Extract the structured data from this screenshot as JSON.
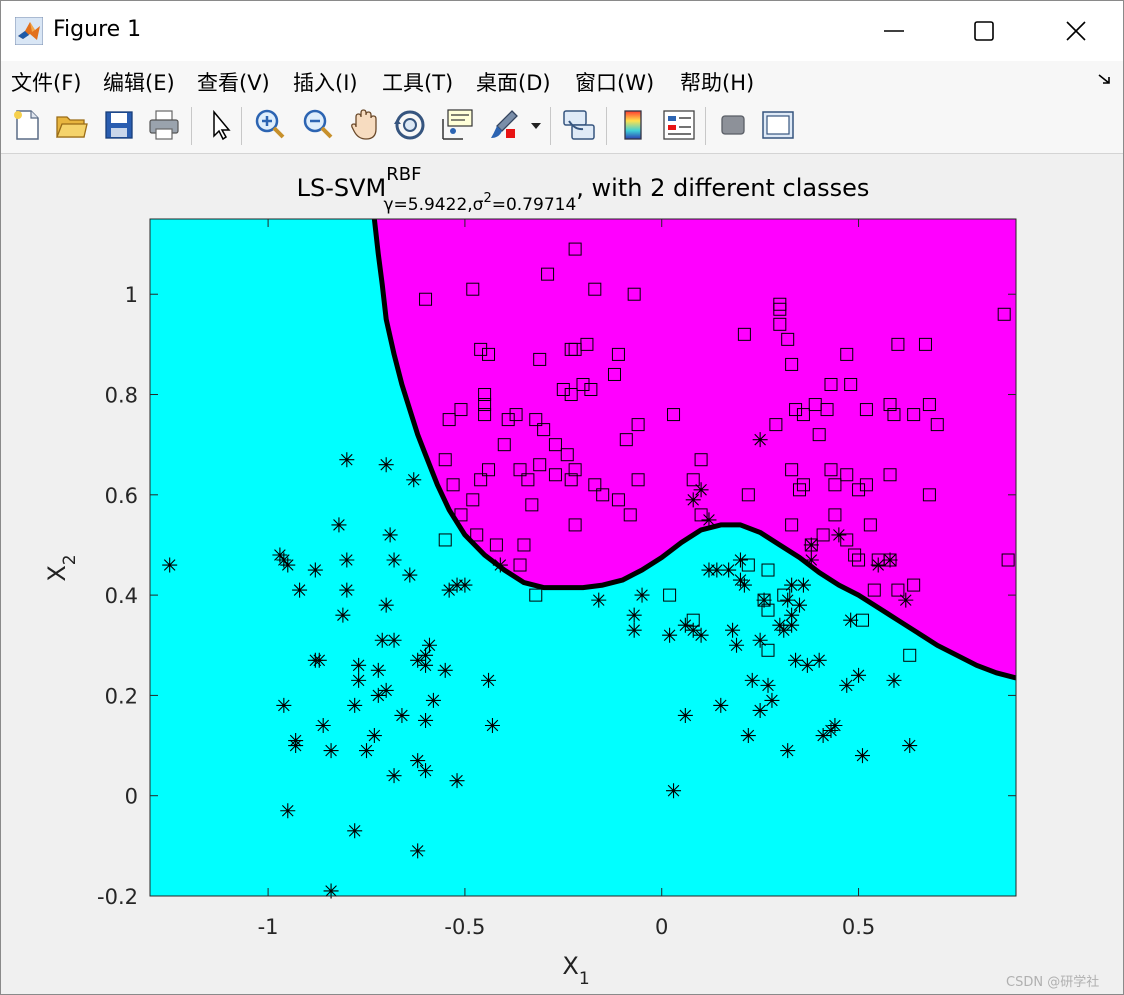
{
  "window": {
    "title": "Figure 1",
    "icon": "matlab-icon",
    "controls": [
      "minimize-icon",
      "maximize-icon",
      "close-icon"
    ]
  },
  "menu": {
    "items": [
      {
        "label": "文件(F)",
        "name": "menu-file"
      },
      {
        "label": "编辑(E)",
        "name": "menu-edit"
      },
      {
        "label": "查看(V)",
        "name": "menu-view"
      },
      {
        "label": "插入(I)",
        "name": "menu-insert"
      },
      {
        "label": "工具(T)",
        "name": "menu-tools"
      },
      {
        "label": "桌面(D)",
        "name": "menu-desktop"
      },
      {
        "label": "窗口(W)",
        "name": "menu-window"
      },
      {
        "label": "帮助(H)",
        "name": "menu-help"
      }
    ],
    "expand_icon": "dock-arrow-icon"
  },
  "toolbar": {
    "buttons": [
      "new-figure-icon",
      "open-file-icon",
      "save-icon",
      "print-icon",
      "pointer-icon",
      "zoom-in-icon",
      "zoom-out-icon",
      "pan-icon",
      "rotate-3d-icon",
      "data-cursor-icon",
      "brush-icon",
      "link-plot-icon",
      "colorbar-icon",
      "legend-icon",
      "hide-plot-tools-icon",
      "show-plot-tools-icon"
    ]
  },
  "watermark": "CSDN @研学社",
  "chart_data": {
    "type": "scatter",
    "title": {
      "main": "LS-SVM",
      "sup": "RBF",
      "sub": "γ=5.9422,σ",
      "sub_sup": "2",
      "sub_tail": "=0.79714",
      "tail": ", with 2 different classes"
    },
    "xlabel": {
      "main": "X",
      "sub": "1"
    },
    "ylabel": {
      "main": "X",
      "sub": "2"
    },
    "xlim": [
      -1.3,
      0.9
    ],
    "ylim": [
      -0.2,
      1.15
    ],
    "xticks": [
      -1,
      -0.5,
      0,
      0.5
    ],
    "yticks": [
      -0.2,
      0,
      0.2,
      0.4,
      0.6,
      0.8,
      1
    ],
    "xtick_labels": [
      "-1",
      "-0.5",
      "0",
      "0.5"
    ],
    "ytick_labels": [
      "-0.2",
      "0",
      "0.2",
      "0.4",
      "0.6",
      "0.8",
      "1"
    ],
    "grid": false,
    "region_colors": {
      "class_negative": "#00ffff",
      "class_positive": "#ff00ff"
    },
    "boundary": {
      "color": "#000000",
      "points": [
        [
          -0.73,
          1.15
        ],
        [
          -0.72,
          1.08
        ],
        [
          -0.71,
          1.02
        ],
        [
          -0.7,
          0.95
        ],
        [
          -0.68,
          0.88
        ],
        [
          -0.66,
          0.82
        ],
        [
          -0.64,
          0.77
        ],
        [
          -0.62,
          0.72
        ],
        [
          -0.6,
          0.68
        ],
        [
          -0.57,
          0.62
        ],
        [
          -0.54,
          0.57
        ],
        [
          -0.5,
          0.52
        ],
        [
          -0.45,
          0.48
        ],
        [
          -0.4,
          0.45
        ],
        [
          -0.35,
          0.425
        ],
        [
          -0.3,
          0.415
        ],
        [
          -0.25,
          0.415
        ],
        [
          -0.2,
          0.415
        ],
        [
          -0.15,
          0.42
        ],
        [
          -0.1,
          0.43
        ],
        [
          -0.05,
          0.45
        ],
        [
          0,
          0.475
        ],
        [
          0.05,
          0.505
        ],
        [
          0.1,
          0.53
        ],
        [
          0.15,
          0.54
        ],
        [
          0.2,
          0.54
        ],
        [
          0.25,
          0.525
        ],
        [
          0.3,
          0.5
        ],
        [
          0.35,
          0.475
        ],
        [
          0.4,
          0.445
        ],
        [
          0.45,
          0.42
        ],
        [
          0.5,
          0.4
        ],
        [
          0.55,
          0.375
        ],
        [
          0.6,
          0.35
        ],
        [
          0.65,
          0.325
        ],
        [
          0.7,
          0.3
        ],
        [
          0.75,
          0.28
        ],
        [
          0.8,
          0.26
        ],
        [
          0.85,
          0.245
        ],
        [
          0.9,
          0.235
        ]
      ]
    },
    "series": [
      {
        "marker": "star",
        "points": [
          [
            -1.25,
            0.46
          ],
          [
            -0.97,
            0.48
          ],
          [
            -0.96,
            0.47
          ],
          [
            -0.95,
            0.46
          ],
          [
            -0.92,
            0.41
          ],
          [
            -0.88,
            0.45
          ],
          [
            -0.87,
            0.27
          ],
          [
            -0.88,
            0.27
          ],
          [
            -0.82,
            0.54
          ],
          [
            -0.8,
            0.67
          ],
          [
            -0.8,
            0.47
          ],
          [
            -0.8,
            0.41
          ],
          [
            -0.81,
            0.36
          ],
          [
            -0.78,
            0.18
          ],
          [
            -0.77,
            0.26
          ],
          [
            -0.77,
            0.23
          ],
          [
            -0.75,
            0.09
          ],
          [
            -0.73,
            0.12
          ],
          [
            -0.72,
            0.25
          ],
          [
            -0.72,
            0.2
          ],
          [
            -0.71,
            0.31
          ],
          [
            -0.7,
            0.38
          ],
          [
            -0.69,
            0.52
          ],
          [
            -0.7,
            0.66
          ],
          [
            -0.7,
            0.21
          ],
          [
            -0.68,
            0.47
          ],
          [
            -0.68,
            0.31
          ],
          [
            -0.66,
            0.16
          ],
          [
            -0.64,
            0.44
          ],
          [
            -0.63,
            0.63
          ],
          [
            -0.62,
            0.27
          ],
          [
            -0.6,
            0.28
          ],
          [
            -0.59,
            0.3
          ],
          [
            -0.6,
            0.26
          ],
          [
            -0.6,
            0.15
          ],
          [
            -0.58,
            0.19
          ],
          [
            -0.6,
            0.05
          ],
          [
            -0.62,
            0.07
          ],
          [
            -0.55,
            0.25
          ],
          [
            -0.54,
            0.41
          ],
          [
            -0.52,
            0.42
          ],
          [
            -0.5,
            0.42
          ],
          [
            -0.52,
            0.03
          ],
          [
            -0.44,
            0.23
          ],
          [
            -0.43,
            0.14
          ],
          [
            -0.96,
            0.18
          ],
          [
            -0.93,
            0.11
          ],
          [
            -0.93,
            0.1
          ],
          [
            -0.86,
            0.14
          ],
          [
            -0.84,
            0.09
          ],
          [
            -0.68,
            0.04
          ],
          [
            -0.95,
            -0.03
          ],
          [
            -0.78,
            -0.07
          ],
          [
            -0.84,
            -0.19
          ],
          [
            -0.62,
            -0.11
          ],
          [
            -0.05,
            0.4
          ],
          [
            -0.07,
            0.36
          ],
          [
            -0.07,
            0.33
          ],
          [
            0.02,
            0.32
          ],
          [
            0.03,
            0.01
          ],
          [
            0.06,
            0.16
          ],
          [
            0.08,
            0.33
          ],
          [
            0.1,
            0.32
          ],
          [
            0.1,
            0.61
          ],
          [
            0.12,
            0.55
          ],
          [
            0.12,
            0.45
          ],
          [
            0.15,
            0.18
          ],
          [
            0.17,
            0.45
          ],
          [
            0.18,
            0.33
          ],
          [
            0.19,
            0.3
          ],
          [
            0.2,
            0.47
          ],
          [
            0.2,
            0.43
          ],
          [
            0.21,
            0.42
          ],
          [
            0.22,
            0.12
          ],
          [
            0.23,
            0.23
          ],
          [
            0.25,
            0.31
          ],
          [
            0.25,
            0.17
          ],
          [
            0.26,
            0.39
          ],
          [
            0.27,
            0.22
          ],
          [
            0.28,
            0.19
          ],
          [
            0.3,
            0.34
          ],
          [
            0.31,
            0.33
          ],
          [
            0.32,
            0.39
          ],
          [
            0.33,
            0.34
          ],
          [
            0.33,
            0.36
          ],
          [
            0.34,
            0.27
          ],
          [
            0.32,
            0.09
          ],
          [
            0.35,
            0.38
          ],
          [
            0.36,
            0.42
          ],
          [
            0.37,
            0.26
          ],
          [
            0.38,
            0.5
          ],
          [
            0.38,
            0.47
          ],
          [
            0.4,
            0.27
          ],
          [
            0.41,
            0.12
          ],
          [
            0.43,
            0.13
          ],
          [
            0.44,
            0.14
          ],
          [
            0.45,
            0.52
          ],
          [
            0.47,
            0.22
          ],
          [
            0.48,
            0.35
          ],
          [
            0.5,
            0.24
          ],
          [
            0.51,
            0.08
          ],
          [
            0.55,
            0.46
          ],
          [
            0.58,
            0.47
          ],
          [
            0.59,
            0.23
          ],
          [
            0.62,
            0.39
          ],
          [
            0.63,
            0.1
          ],
          [
            0.25,
            0.71
          ],
          [
            -0.41,
            0.46
          ],
          [
            0.06,
            0.34
          ],
          [
            0.08,
            0.59
          ],
          [
            0.14,
            0.45
          ],
          [
            0.33,
            0.42
          ],
          [
            -0.16,
            0.39
          ]
        ]
      },
      {
        "marker": "square",
        "points": [
          [
            -0.22,
            1.09
          ],
          [
            -0.29,
            1.04
          ],
          [
            -0.6,
            0.99
          ],
          [
            -0.48,
            1.01
          ],
          [
            -0.17,
            1.01
          ],
          [
            -0.07,
            1.0
          ],
          [
            0.3,
            0.98
          ],
          [
            0.87,
            0.96
          ],
          [
            -0.46,
            0.89
          ],
          [
            -0.44,
            0.88
          ],
          [
            -0.31,
            0.87
          ],
          [
            -0.23,
            0.89
          ],
          [
            -0.22,
            0.89
          ],
          [
            -0.19,
            0.9
          ],
          [
            -0.11,
            0.88
          ],
          [
            0.21,
            0.92
          ],
          [
            0.3,
            0.94
          ],
          [
            0.32,
            0.91
          ],
          [
            0.47,
            0.88
          ],
          [
            0.6,
            0.9
          ],
          [
            0.67,
            0.9
          ],
          [
            -0.45,
            0.8
          ],
          [
            -0.45,
            0.78
          ],
          [
            -0.25,
            0.81
          ],
          [
            -0.23,
            0.8
          ],
          [
            -0.2,
            0.82
          ],
          [
            -0.18,
            0.81
          ],
          [
            -0.12,
            0.84
          ],
          [
            0.33,
            0.86
          ],
          [
            0.43,
            0.82
          ],
          [
            0.48,
            0.82
          ],
          [
            -0.54,
            0.75
          ],
          [
            -0.51,
            0.77
          ],
          [
            -0.45,
            0.76
          ],
          [
            -0.37,
            0.76
          ],
          [
            -0.32,
            0.75
          ],
          [
            -0.3,
            0.73
          ],
          [
            -0.27,
            0.7
          ],
          [
            -0.24,
            0.68
          ],
          [
            -0.09,
            0.71
          ],
          [
            -0.06,
            0.74
          ],
          [
            0.03,
            0.76
          ],
          [
            0.29,
            0.74
          ],
          [
            0.34,
            0.77
          ],
          [
            0.36,
            0.76
          ],
          [
            0.39,
            0.78
          ],
          [
            0.42,
            0.77
          ],
          [
            0.52,
            0.77
          ],
          [
            0.58,
            0.78
          ],
          [
            0.59,
            0.76
          ],
          [
            0.64,
            0.76
          ],
          [
            0.68,
            0.78
          ],
          [
            0.7,
            0.74
          ],
          [
            -0.53,
            0.62
          ],
          [
            -0.48,
            0.59
          ],
          [
            -0.46,
            0.63
          ],
          [
            -0.44,
            0.65
          ],
          [
            -0.4,
            0.7
          ],
          [
            -0.36,
            0.65
          ],
          [
            -0.34,
            0.63
          ],
          [
            -0.27,
            0.64
          ],
          [
            -0.23,
            0.63
          ],
          [
            -0.22,
            0.65
          ],
          [
            -0.17,
            0.62
          ],
          [
            -0.15,
            0.6
          ],
          [
            -0.11,
            0.59
          ],
          [
            -0.08,
            0.56
          ],
          [
            -0.06,
            0.63
          ],
          [
            0.08,
            0.63
          ],
          [
            0.1,
            0.67
          ],
          [
            0.22,
            0.6
          ],
          [
            0.33,
            0.65
          ],
          [
            0.36,
            0.62
          ],
          [
            0.43,
            0.65
          ],
          [
            0.44,
            0.62
          ],
          [
            0.47,
            0.64
          ],
          [
            0.5,
            0.61
          ],
          [
            0.52,
            0.62
          ],
          [
            0.58,
            0.64
          ],
          [
            0.68,
            0.6
          ],
          [
            -0.55,
            0.67
          ],
          [
            -0.51,
            0.56
          ],
          [
            -0.47,
            0.52
          ],
          [
            -0.42,
            0.5
          ],
          [
            -0.35,
            0.5
          ],
          [
            -0.22,
            0.54
          ],
          [
            -0.33,
            0.58
          ],
          [
            0.1,
            0.56
          ],
          [
            0.33,
            0.54
          ],
          [
            0.38,
            0.5
          ],
          [
            0.41,
            0.52
          ],
          [
            0.44,
            0.56
          ],
          [
            0.47,
            0.51
          ],
          [
            0.49,
            0.48
          ],
          [
            0.5,
            0.47
          ],
          [
            0.53,
            0.54
          ],
          [
            0.55,
            0.47
          ],
          [
            0.58,
            0.47
          ],
          [
            0.6,
            0.41
          ],
          [
            0.64,
            0.42
          ],
          [
            0.88,
            0.47
          ],
          [
            -0.55,
            0.51
          ],
          [
            -0.36,
            0.46
          ],
          [
            -0.32,
            0.4
          ],
          [
            0.02,
            0.4
          ],
          [
            0.08,
            0.35
          ],
          [
            0.26,
            0.39
          ],
          [
            0.27,
            0.29
          ],
          [
            0.31,
            0.4
          ],
          [
            0.22,
            0.46
          ],
          [
            0.27,
            0.37
          ],
          [
            0.54,
            0.41
          ],
          [
            0.63,
            0.28
          ],
          [
            0.51,
            0.35
          ],
          [
            0.27,
            0.45
          ],
          [
            0.3,
            0.97
          ],
          [
            0.35,
            0.61
          ],
          [
            -0.39,
            0.75
          ],
          [
            -0.31,
            0.66
          ],
          [
            0.4,
            0.72
          ]
        ]
      }
    ]
  }
}
